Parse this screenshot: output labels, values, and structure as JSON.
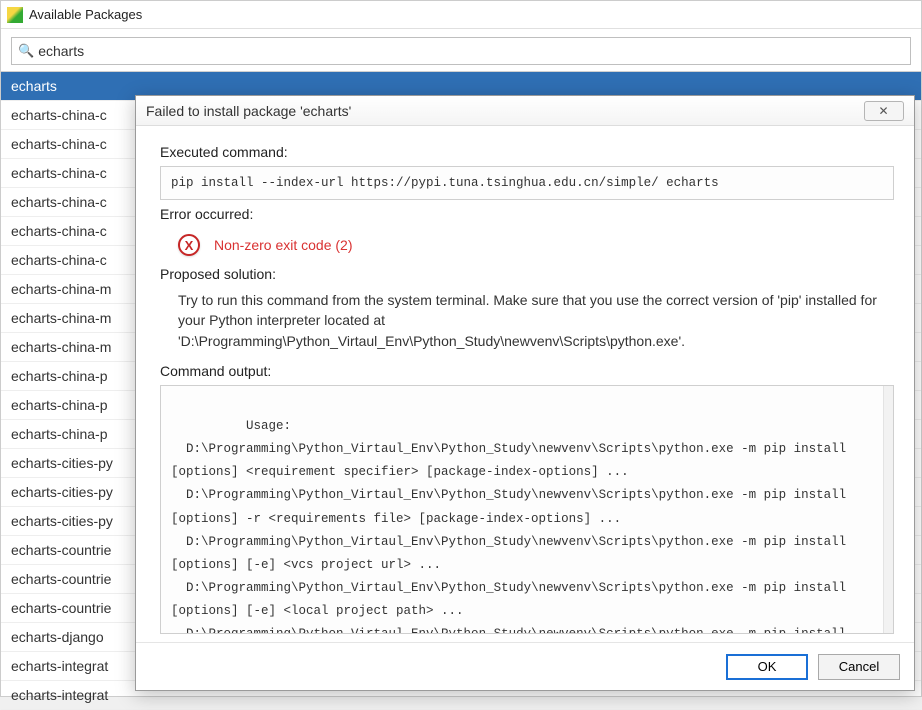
{
  "window": {
    "title": "Available Packages"
  },
  "search": {
    "value": "echarts"
  },
  "packages": [
    "echarts",
    "echarts-china-c",
    "echarts-china-c",
    "echarts-china-c",
    "echarts-china-c",
    "echarts-china-c",
    "echarts-china-c",
    "echarts-china-m",
    "echarts-china-m",
    "echarts-china-m",
    "echarts-china-p",
    "echarts-china-p",
    "echarts-china-p",
    "echarts-cities-py",
    "echarts-cities-py",
    "echarts-cities-py",
    "echarts-countrie",
    "echarts-countrie",
    "echarts-countrie",
    "echarts-django",
    "echarts-integrat",
    "echarts-integrat"
  ],
  "selected_package_index": 0,
  "dialog": {
    "title": "Failed to install package 'echarts'",
    "executed_label": "Executed command:",
    "executed_command": "pip install --index-url https://pypi.tuna.tsinghua.edu.cn/simple/ echarts",
    "error_label": "Error occurred:",
    "error_message": "Non-zero exit code (2)",
    "proposed_label": "Proposed solution:",
    "proposed_text": "Try to run this command from the system terminal. Make sure that you use the correct version of 'pip' installed for your Python interpreter located at 'D:\\Programming\\Python_Virtaul_Env\\Python_Study\\newvenv\\Scripts\\python.exe'.",
    "output_label": "Command output:",
    "output_text": "Usage:\n  D:\\Programming\\Python_Virtaul_Env\\Python_Study\\newvenv\\Scripts\\python.exe -m pip install [options] <requirement specifier> [package-index-options] ...\n  D:\\Programming\\Python_Virtaul_Env\\Python_Study\\newvenv\\Scripts\\python.exe -m pip install [options] -r <requirements file> [package-index-options] ...\n  D:\\Programming\\Python_Virtaul_Env\\Python_Study\\newvenv\\Scripts\\python.exe -m pip install [options] [-e] <vcs project url> ...\n  D:\\Programming\\Python_Virtaul_Env\\Python_Study\\newvenv\\Scripts\\python.exe -m pip install [options] [-e] <local project path> ...\n  D:\\Programming\\Python_Virtaul_Env\\Python_Study\\newvenv\\Scripts\\python.exe -m pip install [options] <archive url/path> ...\n",
    "ok_label": "OK",
    "cancel_label": "Cancel",
    "close_symbol": "✕"
  }
}
